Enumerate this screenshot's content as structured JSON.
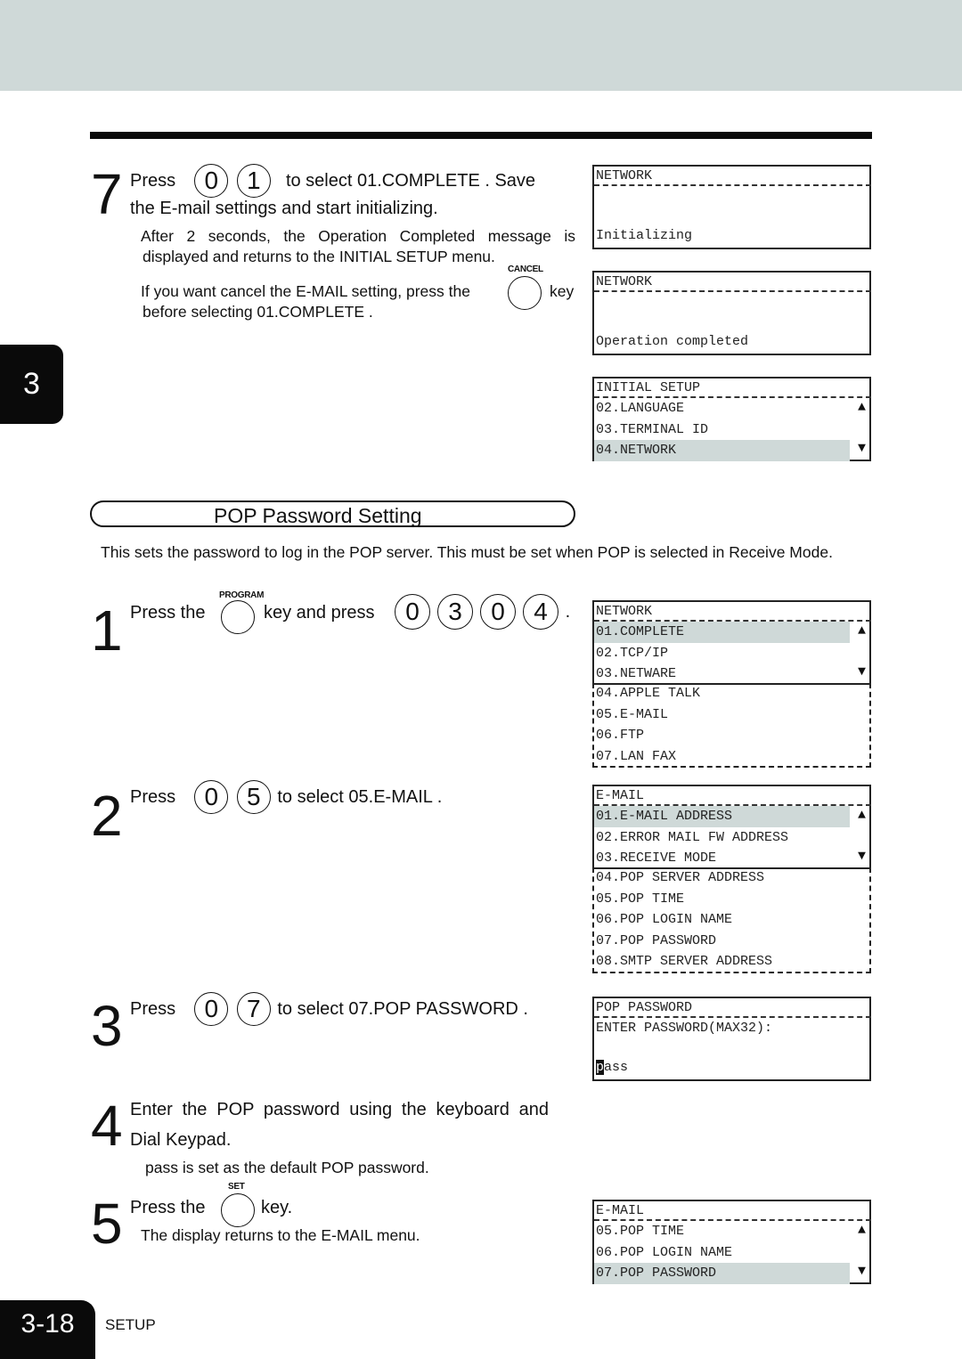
{
  "page": {
    "chapter": "3",
    "page_number": "3-18",
    "footer_label": "SETUP"
  },
  "step7": {
    "number": "7",
    "line1_prefix": "Press",
    "keys": [
      "0",
      "1"
    ],
    "line1_suffix": "to select  01.COMPLETE .  Save",
    "line2": "the E-mail settings and start initializing.",
    "note1_line1": "After 2 seconds, the Operation Completed message is",
    "note1_line2": "displayed and returns to the INITIAL SETUP menu.",
    "cancel_key_label": "CANCEL",
    "note2_prefix": "If you want cancel the E-MAIL setting, press the",
    "note2_suffix": "key",
    "note2_line2": "before selecting  01.COMPLETE ."
  },
  "section": {
    "title": "POP Password Setting",
    "description": "This sets the password to log in the POP server.  This must be set when  POP  is selected in  Receive Mode."
  },
  "step1": {
    "number": "1",
    "prefix": "Press the",
    "program_key_label": "PROGRAM",
    "middle": "key and press",
    "keys": [
      "0",
      "3",
      "0",
      "4"
    ],
    "suffix": "."
  },
  "step2": {
    "number": "2",
    "prefix": "Press",
    "keys": [
      "0",
      "5"
    ],
    "suffix": "to select  05.E-MAIL ."
  },
  "step3": {
    "number": "3",
    "prefix": "Press",
    "keys": [
      "0",
      "7"
    ],
    "suffix": "to select  07.POP PASSWORD ."
  },
  "step4": {
    "number": "4",
    "line1": "Enter the POP password using the keyboard and",
    "line2": "Dial Keypad.",
    "note": "pass  is set as the default POP password."
  },
  "step5": {
    "number": "5",
    "prefix": "Press the",
    "set_key_label": "SET",
    "suffix": "key.",
    "note": "The display returns to the E-MAIL menu."
  },
  "lcd": {
    "initializing": {
      "title": "NETWORK",
      "message": "Initializing"
    },
    "completed": {
      "title": "NETWORK",
      "message": "Operation completed"
    },
    "initial_setup": {
      "title": "INITIAL SETUP",
      "rows": [
        "02.LANGUAGE",
        "03.TERMINAL ID",
        "04.NETWORK"
      ],
      "selected": "04.NETWORK"
    },
    "network_menu": {
      "title": "NETWORK",
      "rows": [
        "01.COMPLETE",
        "02.TCP/IP",
        "03.NETWARE"
      ],
      "more_rows": [
        "04.APPLE TALK",
        "05.E-MAIL",
        "06.FTP",
        "07.LAN FAX"
      ],
      "selected": "01.COMPLETE"
    },
    "email_menu": {
      "title": "E-MAIL",
      "rows": [
        "01.E-MAIL ADDRESS",
        "02.ERROR MAIL FW ADDRESS",
        "03.RECEIVE MODE"
      ],
      "more_rows": [
        "04.POP SERVER ADDRESS",
        "05.POP TIME",
        "06.POP LOGIN NAME",
        "07.POP PASSWORD",
        "08.SMTP SERVER ADDRESS"
      ],
      "selected": "01.E-MAIL ADDRESS"
    },
    "pop_password": {
      "title": "POP PASSWORD",
      "prompt": "ENTER PASSWORD(MAX32):",
      "value_cursor_char": "p",
      "value_rest": "ass"
    },
    "email_menu_after": {
      "title": "E-MAIL",
      "rows": [
        "05.POP TIME",
        "06.POP LOGIN NAME",
        "07.POP PASSWORD"
      ],
      "selected": "07.POP PASSWORD"
    },
    "arrow_up": "▲",
    "arrow_down": "▼"
  }
}
